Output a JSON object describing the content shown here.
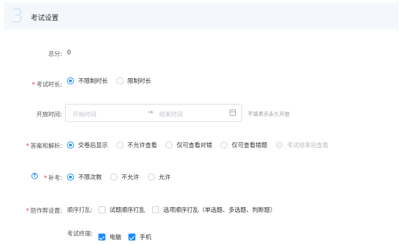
{
  "header": {
    "step": "3",
    "title": "考试设置"
  },
  "total_score": {
    "label": "总分:",
    "value": "0"
  },
  "duration": {
    "required": "*",
    "label": "考试时长:",
    "options": [
      {
        "label": "不限制时长",
        "checked": true
      },
      {
        "label": "限制时长",
        "checked": false
      }
    ]
  },
  "open_time": {
    "label": "开放时间:",
    "start_placeholder": "开始时间",
    "arrow": "→",
    "end_placeholder": "结束时间",
    "hint": "不填表示永久开放"
  },
  "answers": {
    "required": "*",
    "label": "答案和解析:",
    "options": [
      {
        "label": "交卷后显示",
        "checked": true,
        "disabled": false
      },
      {
        "label": "不允许查看",
        "checked": false,
        "disabled": false
      },
      {
        "label": "仅可查看对错",
        "checked": false,
        "disabled": false
      },
      {
        "label": "仅可查看错题",
        "checked": false,
        "disabled": false
      },
      {
        "label": "考试结束后查看",
        "checked": false,
        "disabled": true
      }
    ]
  },
  "retake": {
    "help_icon": "question-circle-icon",
    "help_glyph": "?",
    "required": "*",
    "label": "补考:",
    "options": [
      {
        "label": "不限次数",
        "checked": true
      },
      {
        "label": "不允许",
        "checked": false
      },
      {
        "label": "允许",
        "checked": false
      }
    ]
  },
  "anti_cheat": {
    "required": "*",
    "label": "防作弊设置:",
    "shuffle_label": "顺序打乱:",
    "shuffle_options": [
      {
        "label": "试题顺序打乱",
        "checked": false
      },
      {
        "label": "选项顺序打乱（单选题、多选题、判断题）",
        "checked": false
      }
    ],
    "terminal_label": "考试终端:",
    "terminal_options": [
      {
        "label": "电脑",
        "checked": true
      },
      {
        "label": "手机",
        "checked": true
      }
    ]
  },
  "colors": {
    "accent": "#1a8cff",
    "required": "#f5222d",
    "header_bg": "#f4f7fb"
  }
}
